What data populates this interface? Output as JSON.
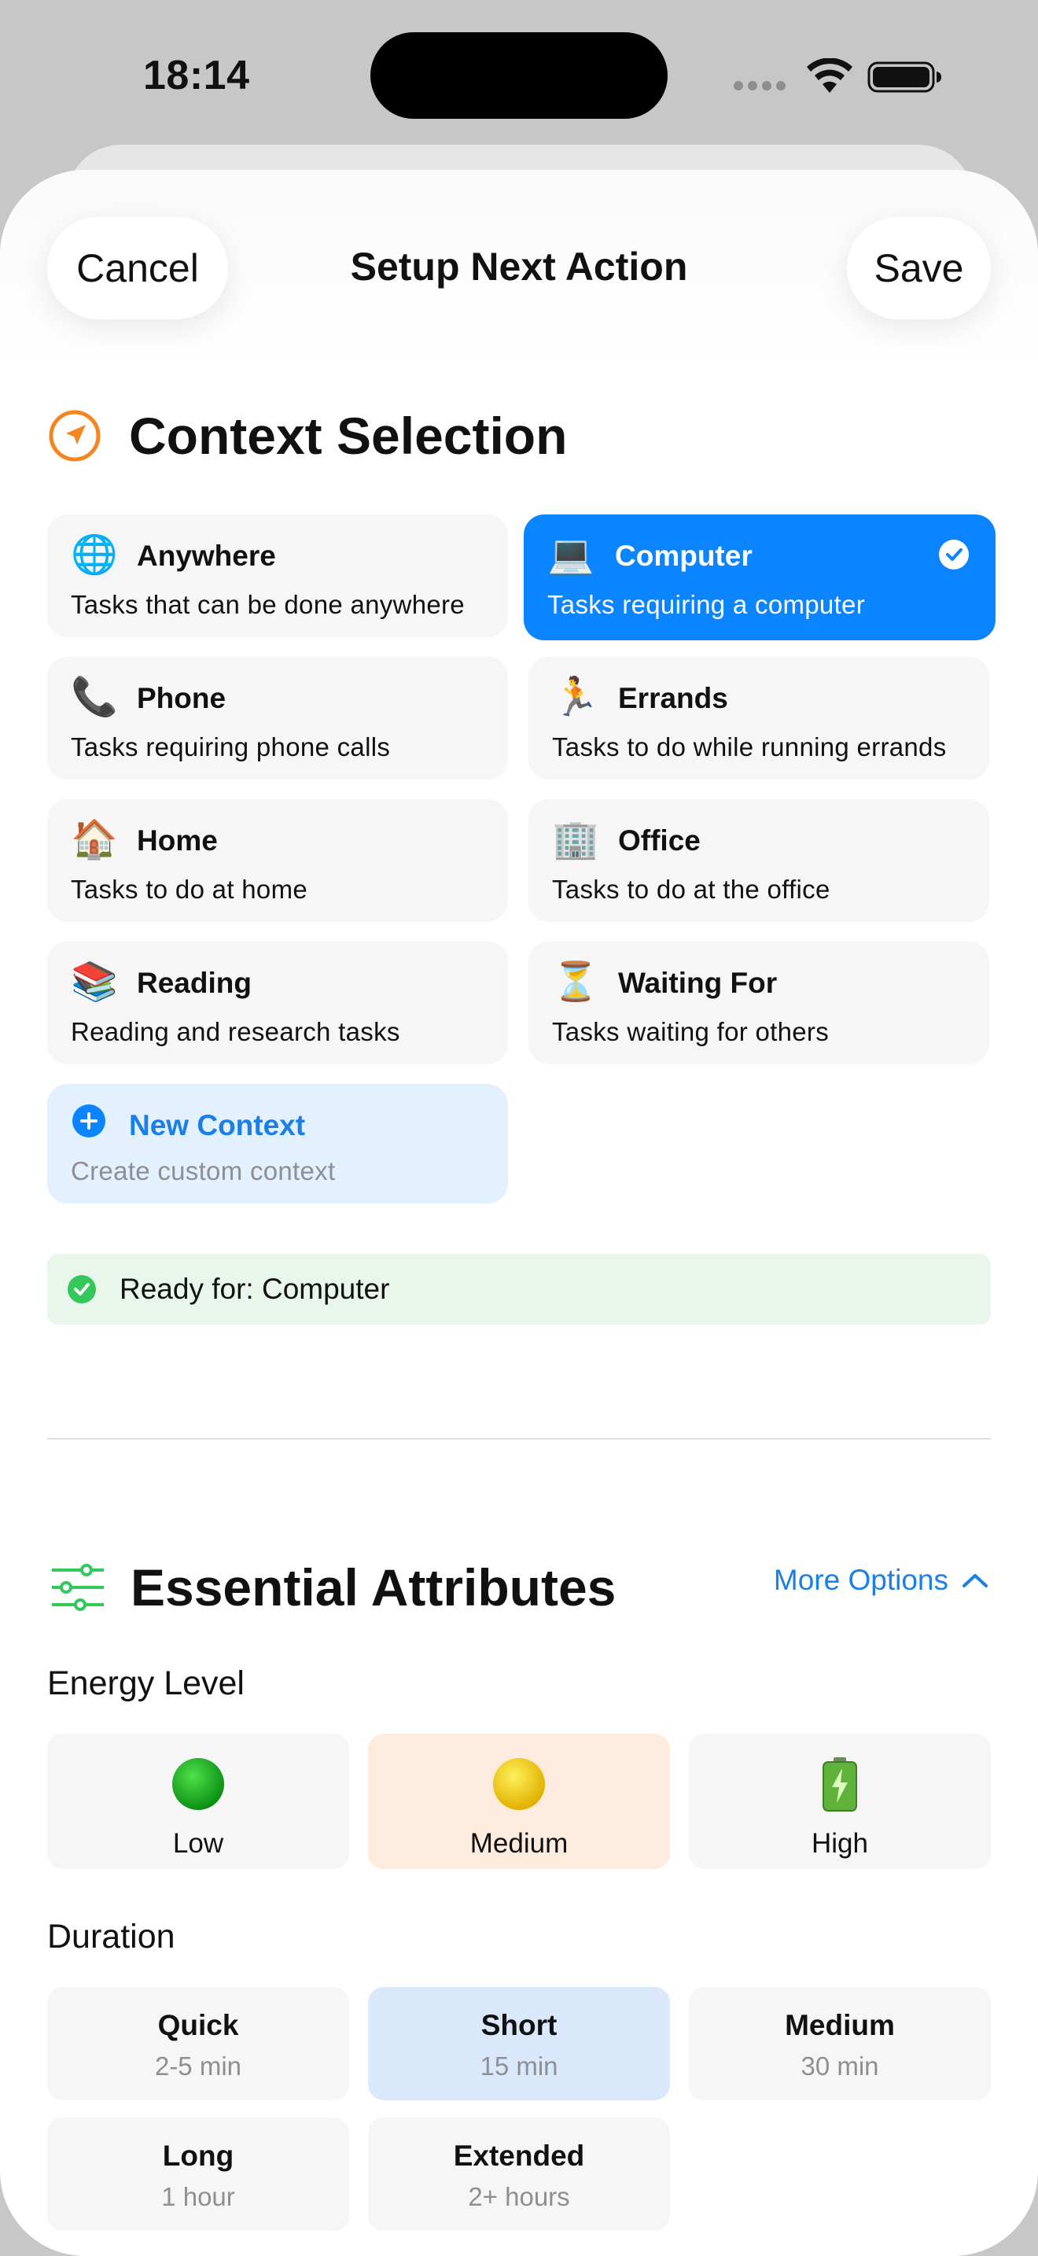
{
  "status_bar": {
    "time": "18:14"
  },
  "nav": {
    "cancel_label": "Cancel",
    "title": "Setup Next Action",
    "save_label": "Save"
  },
  "context_section": {
    "title": "Context Selection",
    "contexts": [
      {
        "icon": "🌐",
        "name": "Anywhere",
        "description": "Tasks that can be done anywhere",
        "selected": false
      },
      {
        "icon": "💻",
        "name": "Computer",
        "description": "Tasks requiring a computer",
        "selected": true
      },
      {
        "icon": "📞",
        "name": "Phone",
        "description": "Tasks requiring phone calls",
        "selected": false
      },
      {
        "icon": "🏃",
        "name": "Errands",
        "description": "Tasks to do while running errands",
        "selected": false
      },
      {
        "icon": "🏠",
        "name": "Home",
        "description": "Tasks to do at home",
        "selected": false
      },
      {
        "icon": "🏢",
        "name": "Office",
        "description": "Tasks to do at the office",
        "selected": false
      },
      {
        "icon": "📚",
        "name": "Reading",
        "description": "Reading and research tasks",
        "selected": false
      },
      {
        "icon": "⏳",
        "name": "Waiting For",
        "description": "Tasks waiting for others",
        "selected": false
      }
    ],
    "new_context": {
      "name": "New Context",
      "description": "Create custom context"
    },
    "ready_text": "Ready for: Computer"
  },
  "attributes_section": {
    "title": "Essential Attributes",
    "more_options_label": "More Options",
    "energy": {
      "label": "Energy Level",
      "options": [
        {
          "label": "Low",
          "icon": "green-circle",
          "selected": false
        },
        {
          "label": "Medium",
          "icon": "yellow-circle",
          "selected": true
        },
        {
          "label": "High",
          "icon": "battery-charging",
          "selected": false
        }
      ]
    },
    "duration": {
      "label": "Duration",
      "options": [
        {
          "title": "Quick",
          "subtitle": "2-5 min",
          "selected": false
        },
        {
          "title": "Short",
          "subtitle": "15 min",
          "selected": true
        },
        {
          "title": "Medium",
          "subtitle": "30 min",
          "selected": false
        },
        {
          "title": "Long",
          "subtitle": "1 hour",
          "selected": false
        },
        {
          "title": "Extended",
          "subtitle": "2+ hours",
          "selected": false
        }
      ]
    }
  },
  "colors": {
    "accent": "#0a84ff",
    "context_icon": "#f4851f",
    "attributes_icon": "#34c759",
    "ready_green": "#34c759"
  }
}
